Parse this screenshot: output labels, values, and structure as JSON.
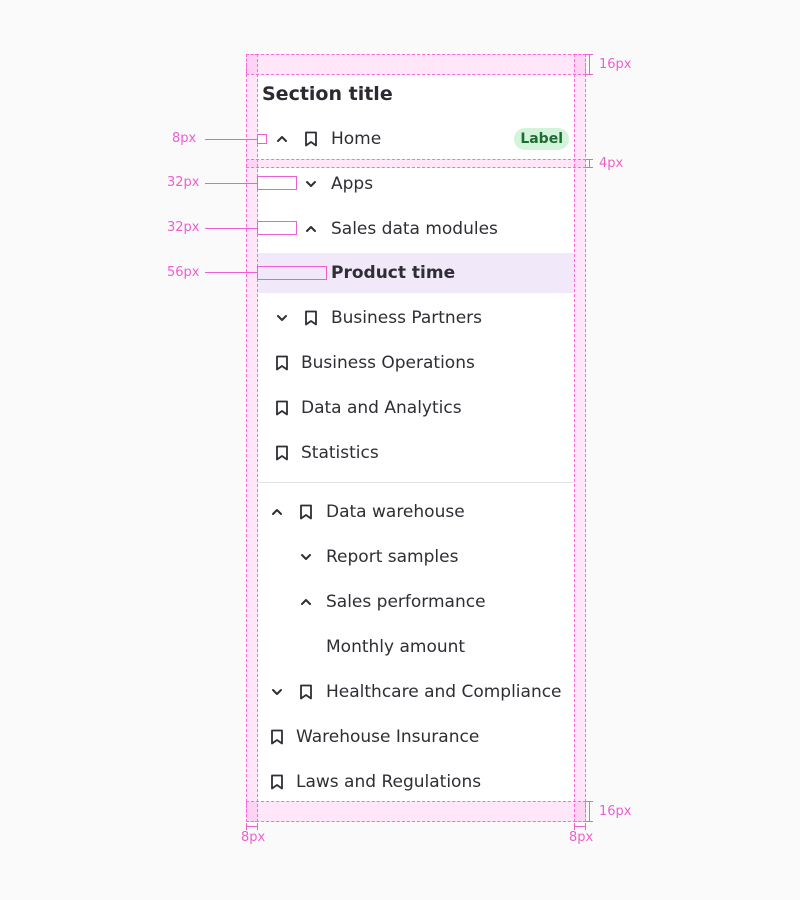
{
  "panel": {
    "section_title": "Section title"
  },
  "nav": {
    "home": {
      "label": "Home",
      "badge": "Label"
    },
    "apps": "Apps",
    "sales_data_modules": "Sales data modules",
    "product_time": "Product time",
    "business_partners": "Business Partners",
    "business_operations": "Business Operations",
    "data_and_analytics": "Data and Analytics",
    "statistics": "Statistics",
    "data_warehouse": "Data warehouse",
    "report_samples": "Report samples",
    "sales_performance": "Sales performance",
    "monthly_amount": "Monthly amount",
    "healthcare": "Healthcare and Compliance",
    "warehouse_insurance": "Warehouse Insurance",
    "laws": "Laws and Regulations"
  },
  "spec": {
    "top_padding": "16px",
    "bottom_padding": "16px",
    "row_gap": "4px",
    "indent_1": "8px",
    "indent_2": "32px",
    "indent_3": "32px",
    "indent_4": "56px",
    "left_padding": "8px",
    "right_padding": "8px"
  },
  "colors": {
    "spec": "#ee5fd0",
    "selected_bg": "#f1e8f9",
    "badge_bg": "#d4f3db",
    "badge_text": "#1e6b33"
  },
  "icons": {
    "expand": "chevron-up-icon",
    "collapse": "chevron-down-icon",
    "page": "bookmark-icon"
  }
}
